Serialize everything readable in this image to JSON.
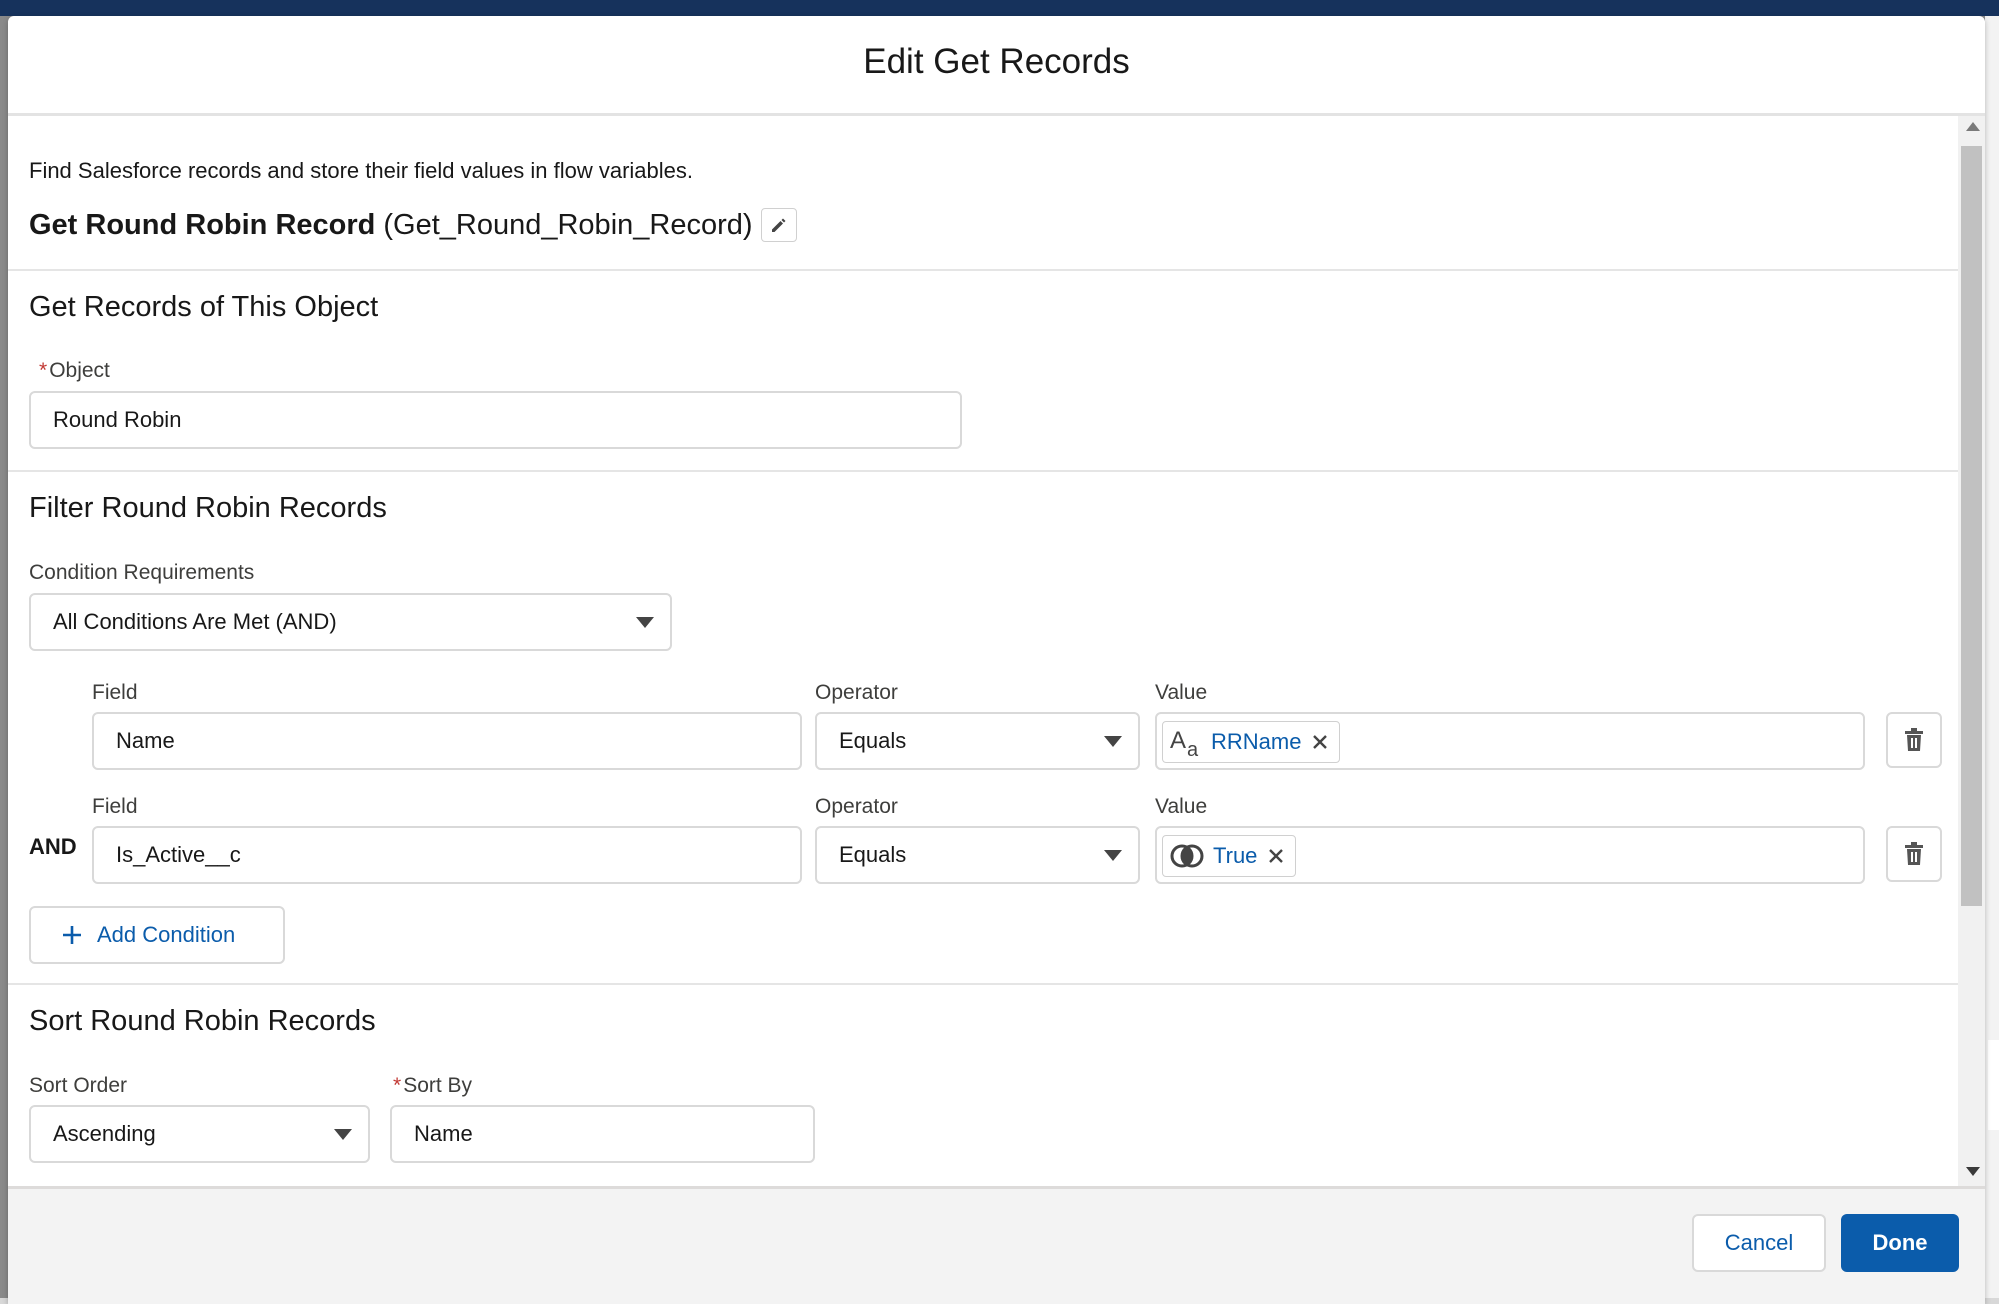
{
  "modal": {
    "title": "Edit Get Records",
    "description": "Find Salesforce records and store their field values in flow variables.",
    "element_label": "Get Round Robin Record",
    "element_api": "(Get_Round_Robin_Record)"
  },
  "object_section": {
    "title": "Get Records of This Object",
    "required_mark": "*",
    "object_label": "Object",
    "object_value": "Round Robin"
  },
  "filter_section": {
    "title": "Filter Round Robin Records",
    "requirements_label": "Condition Requirements",
    "requirements_value": "All Conditions Are Met (AND)",
    "conditions": [
      {
        "prefix": "",
        "field_label": "Field",
        "field_value": "Name",
        "operator_label": "Operator",
        "operator_value": "Equals",
        "value_label": "Value",
        "value_pill": "RRName",
        "value_icon": "text-type-icon"
      },
      {
        "prefix": "AND",
        "field_label": "Field",
        "field_value": "Is_Active__c",
        "operator_label": "Operator",
        "operator_value": "Equals",
        "value_label": "Value",
        "value_pill": "True",
        "value_icon": "boolean-toggle-icon"
      }
    ],
    "add_condition_label": "Add Condition"
  },
  "sort_section": {
    "title": "Sort Round Robin Records",
    "sort_order_label": "Sort Order",
    "sort_order_value": "Ascending",
    "required_mark": "*",
    "sort_by_label": "Sort By",
    "sort_by_value": "Name"
  },
  "footer": {
    "cancel_label": "Cancel",
    "done_label": "Done"
  },
  "colors": {
    "brand_blue": "#0b5cab",
    "header_navy": "#16325c",
    "required_red": "#c23934"
  }
}
